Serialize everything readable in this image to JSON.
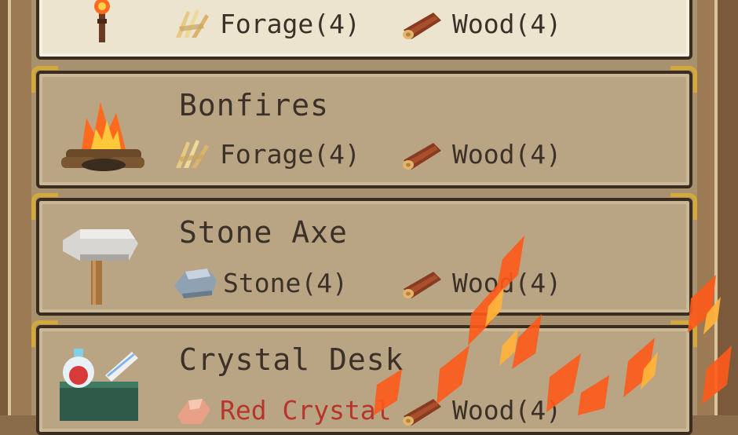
{
  "recipes": [
    {
      "name": "",
      "icon": "torch-icon",
      "selected": true,
      "ingredients": [
        {
          "label": "Forage(4)",
          "icon": "forage-icon"
        },
        {
          "label": "Wood(4)",
          "icon": "wood-icon"
        }
      ]
    },
    {
      "name": "Bonfires",
      "icon": "bonfire-icon",
      "selected": false,
      "ingredients": [
        {
          "label": "Forage(4)",
          "icon": "forage-icon"
        },
        {
          "label": "Wood(4)",
          "icon": "wood-icon"
        }
      ]
    },
    {
      "name": "Stone Axe",
      "icon": "stone-axe-icon",
      "selected": false,
      "ingredients": [
        {
          "label": "Stone(4)",
          "icon": "stone-icon"
        },
        {
          "label": "Wood(4)",
          "icon": "wood-icon"
        }
      ]
    },
    {
      "name": "Crystal Desk",
      "icon": "crystal-desk-icon",
      "selected": false,
      "ingredients": [
        {
          "label": "Red Crystal",
          "icon": "red-crystal-icon"
        },
        {
          "label": "Wood(4)",
          "icon": "wood-icon"
        }
      ]
    }
  ],
  "colors": {
    "text": "#3b3128",
    "row_bg": "#b9a584",
    "selected_bg": "#ece4cf",
    "gold_trim": "#d4a93a",
    "flame": "#ff5a1a"
  }
}
